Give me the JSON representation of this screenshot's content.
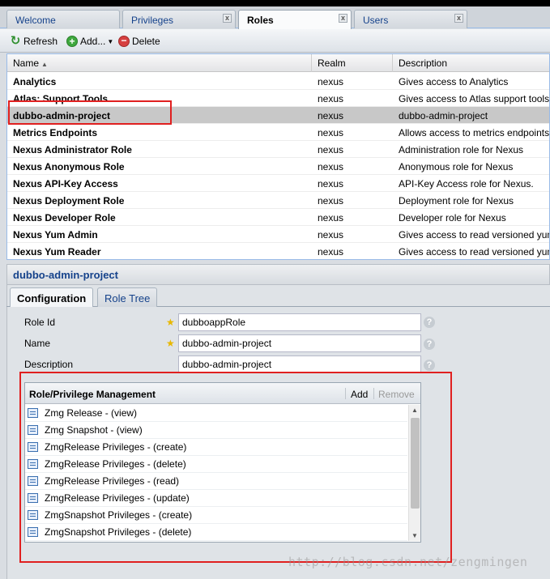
{
  "tabs": [
    {
      "label": "Welcome",
      "closable": false
    },
    {
      "label": "Privileges",
      "closable": true
    },
    {
      "label": "Roles",
      "closable": true,
      "active": true
    },
    {
      "label": "Users",
      "closable": true
    }
  ],
  "tab_close_glyph": "x",
  "toolbar": {
    "refresh_label": "Refresh",
    "add_label": "Add...",
    "delete_label": "Delete"
  },
  "grid": {
    "columns": [
      "Name",
      "Realm",
      "Description"
    ],
    "sort_glyph": "▲",
    "rows": [
      {
        "name": "Analytics",
        "realm": "nexus",
        "description": "Gives access to Analytics"
      },
      {
        "name": "Atlas: Support Tools",
        "realm": "nexus",
        "description": "Gives access to Atlas support tools"
      },
      {
        "name": "dubbo-admin-project",
        "realm": "nexus",
        "description": "dubbo-admin-project",
        "selected": true
      },
      {
        "name": "Metrics Endpoints",
        "realm": "nexus",
        "description": "Allows access to metrics endpoints"
      },
      {
        "name": "Nexus Administrator Role",
        "realm": "nexus",
        "description": "Administration role for Nexus"
      },
      {
        "name": "Nexus Anonymous Role",
        "realm": "nexus",
        "description": "Anonymous role for Nexus"
      },
      {
        "name": "Nexus API-Key Access",
        "realm": "nexus",
        "description": "API-Key Access role for Nexus."
      },
      {
        "name": "Nexus Deployment Role",
        "realm": "nexus",
        "description": "Deployment role for Nexus"
      },
      {
        "name": "Nexus Developer Role",
        "realm": "nexus",
        "description": "Developer role for Nexus"
      },
      {
        "name": "Nexus Yum Admin",
        "realm": "nexus",
        "description": "Gives access to read versioned yum"
      },
      {
        "name": "Nexus Yum Reader",
        "realm": "nexus",
        "description": "Gives access to read versioned yum"
      }
    ]
  },
  "detail": {
    "title": "dubbo-admin-project",
    "subtabs": [
      "Configuration",
      "Role Tree"
    ],
    "form": {
      "role_id_label": "Role Id",
      "role_id_value": "dubboappRole",
      "name_label": "Name",
      "name_value": "dubbo-admin-project",
      "description_label": "Description",
      "description_value": "dubbo-admin-project",
      "required_glyph": "★",
      "help_glyph": "?"
    },
    "privileges": {
      "title": "Role/Privilege Management",
      "add_label": "Add",
      "remove_label": "Remove",
      "items": [
        "Zmg Release - (view)",
        "Zmg Snapshot - (view)",
        "ZmgRelease Privileges - (create)",
        "ZmgRelease Privileges - (delete)",
        "ZmgRelease Privileges - (read)",
        "ZmgRelease Privileges - (update)",
        "ZmgSnapshot Privileges - (create)",
        "ZmgSnapshot Privileges - (delete)"
      ]
    }
  },
  "watermark": "http://blog.csdn.net/zengmingen",
  "colors": {
    "highlight_red": "#e02020",
    "selected_row": "#c8c8c8",
    "tab_text": "#15428b"
  }
}
